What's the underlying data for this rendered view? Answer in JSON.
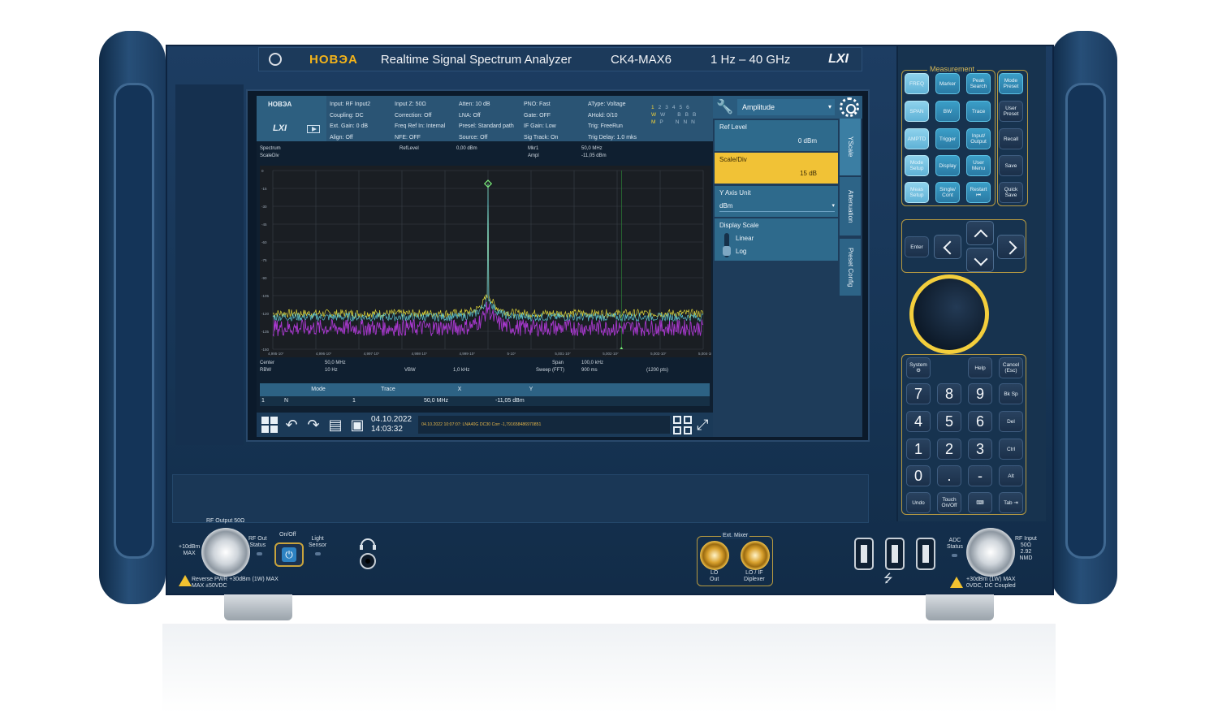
{
  "header": {
    "brand": "НОВЭА",
    "title": "Realtime Signal Spectrum Analyzer",
    "model": "CK4-MAX6",
    "freq_range": "1 Hz – 40 GHz",
    "lxi": "LXI"
  },
  "screen": {
    "logo_brand": "НОВЭА",
    "logo_lxi": "LXI",
    "info": {
      "col1": [
        "Input: RF Input2",
        "Coupling: DC",
        "Ext. Gain: 0 dB",
        "Align: Off"
      ],
      "col2": [
        "Input Z: 50Ω",
        "Correction: Off",
        "Freq Ref In: Internal",
        "NFE: OFF"
      ],
      "col3": [
        "Atten: 10 dB",
        "LNA: Off",
        "Presel: Standard path",
        "Source: Off"
      ],
      "col4": [
        "PNO: Fast",
        "Gate: OFF",
        "IF Gain: Low",
        "Sig Track: On"
      ],
      "col5": [
        "AType: Voltage",
        "AHold: 0/10",
        "Trig: FreeRun",
        "Trig Delay: 1.0 mks"
      ]
    },
    "trace_grid": {
      "numbers": [
        "1",
        "2",
        "3",
        "4",
        "5",
        "6"
      ],
      "row2": [
        "W",
        "W",
        "",
        "B",
        "B",
        "B"
      ],
      "row3": [
        "M",
        "P",
        "",
        "N",
        "N",
        "N"
      ]
    },
    "plot_header": {
      "name": "Spectrum",
      "scale": "ScaleDiv",
      "ref_label": "RefLevel",
      "ref_value": "0,00 dBm",
      "mkr_label": "Mkr1",
      "mkr_freq": "50,0 MHz",
      "ampl_label": "Ampl",
      "ampl_value": "-11,05 dBm"
    },
    "plot_footer": {
      "center_label": "Center",
      "center_value": "50,0 MHz",
      "rbw_label": "RBW",
      "rbw_value": "10 Hz",
      "vbw_label": "VBW",
      "vbw_value": "1,0 kHz",
      "span_label": "Span",
      "span_value": "100,0 kHz",
      "sweep_label": "Sweep (FFT)",
      "sweep_value": "900 ms",
      "points": "(1200 pts)"
    },
    "marker_table": {
      "headers": [
        "",
        "Mode",
        "Trace",
        "X",
        "Y",
        "",
        ""
      ],
      "row": [
        "1",
        "N",
        "1",
        "50,0 MHz",
        "-11,05 dBm",
        "",
        ""
      ]
    },
    "taskbar": {
      "date": "04.10.2022",
      "time": "14:03:32",
      "status_message": "04.10.2022 10:07:07: LNA40G DC30 Corr -1,791658486970851"
    }
  },
  "softmenu": {
    "dropdown": "Amplitude",
    "ref_level_label": "Ref Level",
    "ref_level_value": "0 dBm",
    "scale_div_label": "Scale/Div",
    "scale_div_value": "15 dB",
    "y_axis_unit_label": "Y Axis Unit",
    "y_axis_unit_value": "dBm",
    "display_scale_label": "Display Scale",
    "display_scale_options": [
      "Linear",
      "Log"
    ],
    "vtabs": [
      "YScale",
      "Attenuation",
      "Preset Config"
    ]
  },
  "keypad": {
    "measurement_label": "Measurement",
    "measure_keys": [
      "FREQ",
      "Marker",
      "Peak Search",
      "Mode Preset",
      "SPAN",
      "BW",
      "Trace",
      "User Preset",
      "AMPTD",
      "Trigger",
      "Input/ Output",
      "Recall",
      "Mode Setup",
      "Display",
      "User Menu",
      "Save",
      "Meas Setup",
      "Single/ Cont",
      "Restart ⏮",
      "Quick Save"
    ],
    "enter": "Enter",
    "system": "System ⚙",
    "help": "Help",
    "cancel": "Cancel (Esc)",
    "bksp": "Bk Sp",
    "del": "Del",
    "ctrl": "Ctrl",
    "alt": "Alt",
    "undo": "Undo",
    "touch": "Touch On/Off",
    "keyboard_glyph": "⌨",
    "tab": "Tab ⇥",
    "numbers": [
      "7",
      "8",
      "9",
      "4",
      "5",
      "6",
      "1",
      "2",
      "3",
      "0",
      ".",
      "-"
    ]
  },
  "front_panel": {
    "rf_output": "RF Output 50Ω",
    "rf_output_level": "+10dBm\nMAX",
    "rf_out_status": "RF Out\nStatus",
    "on_off": "On/Off",
    "light_sensor": "Light\nSensor",
    "reverse_pwr": "Reverse PWR +30dBm (1W) MAX\nMAX ±50VDC",
    "ext_mixer": "Ext. Mixer",
    "lo_out": "LO\nOut",
    "lo_if": "LO / IF\nDiplexer",
    "adc_status": "ADC\nStatus",
    "rf_input": "RF Input\n50Ω\n2.92\nNMD",
    "rf_input_max": "+30dBm (1W) MAX\n0VDC, DC Coupled"
  },
  "colors": {
    "chassis": "#1d3d62",
    "accent_gold": "#f1c236",
    "key_teal": "#3b9ec7",
    "trace_yellow": "#e6dc3a",
    "trace_cyan": "#5fc8d6",
    "trace_magenta": "#b03ad8",
    "marker_green": "#7cf07a"
  },
  "chart_data": {
    "type": "line",
    "title": "Spectrum",
    "xlabel": "",
    "ylabel": "",
    "x_ticks": [
      "4,995·10⁷",
      "4,996·10⁷",
      "4,997·10⁷",
      "4,998·10⁷",
      "4,999·10⁷",
      "5·10⁷",
      "5,001·10⁷",
      "5,002·10⁷",
      "5,003·10⁷",
      "5,004·10⁷"
    ],
    "y_ticks": [
      "0",
      "-15",
      "-30",
      "-45",
      "-60",
      "-75",
      "-90",
      "-105",
      "-120",
      "-135",
      "-150"
    ],
    "xlim": [
      49950000,
      50050000
    ],
    "ylim": [
      -150,
      0
    ],
    "grid": true,
    "marker": {
      "x": 50000000,
      "y": -11.05
    },
    "series": [
      {
        "color": "#e6dc3a",
        "noise_floor_db": -120,
        "peak_x": 50000000,
        "peak_db": -11.05
      },
      {
        "color": "#5fc8d6",
        "noise_floor_db": -123,
        "peak_x": 50000000,
        "peak_db": -11.05
      },
      {
        "color": "#b03ad8",
        "noise_floor_db": -132,
        "peak_x": 50000000,
        "peak_db": -115
      }
    ]
  }
}
